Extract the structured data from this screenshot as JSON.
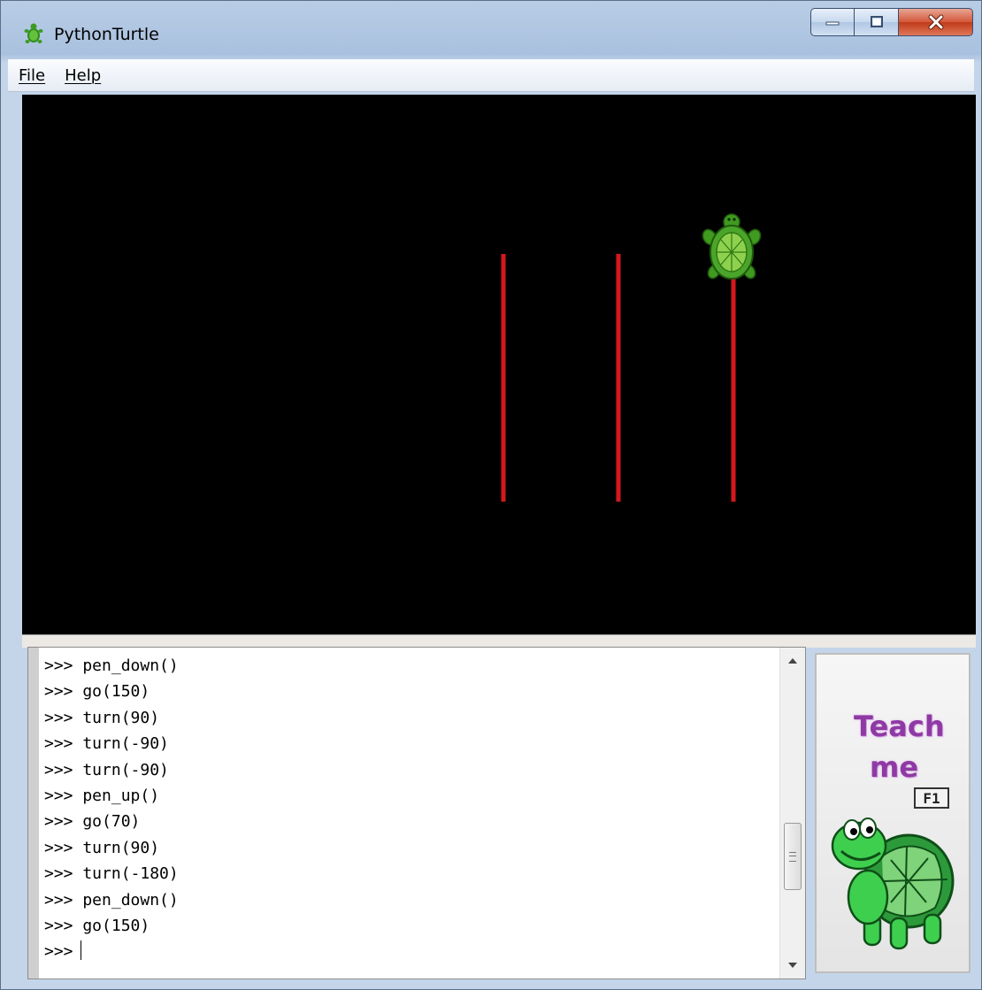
{
  "window": {
    "title": "PythonTurtle",
    "title_icon": "turtle-app-icon",
    "controls": {
      "minimize_icon": "minimize-icon",
      "maximize_icon": "maximize-icon",
      "close_icon": "close-icon"
    }
  },
  "menu": {
    "items": [
      {
        "label": "File"
      },
      {
        "label": "Help"
      }
    ]
  },
  "canvas": {
    "background": "#000000",
    "pen_color": "#d4181c",
    "turtle_icon": "turtle-sprite-icon"
  },
  "shell": {
    "prompt": ">>>",
    "lines": [
      ">>> pen_down()",
      ">>> go(150)",
      ">>> turn(90)",
      ">>> turn(-90)",
      ">>> turn(-90)",
      ">>> pen_up()",
      ">>> go(70)",
      ">>> turn(90)",
      ">>> turn(-180)",
      ">>> pen_down()",
      ">>> go(150)"
    ],
    "current_input": ">>> "
  },
  "help_panel": {
    "title_line1": "Teach",
    "title_line2": "me",
    "key_hint": "F1",
    "mascot_icon": "turtle-mascot-icon",
    "title_color": "#8e3aa4"
  }
}
